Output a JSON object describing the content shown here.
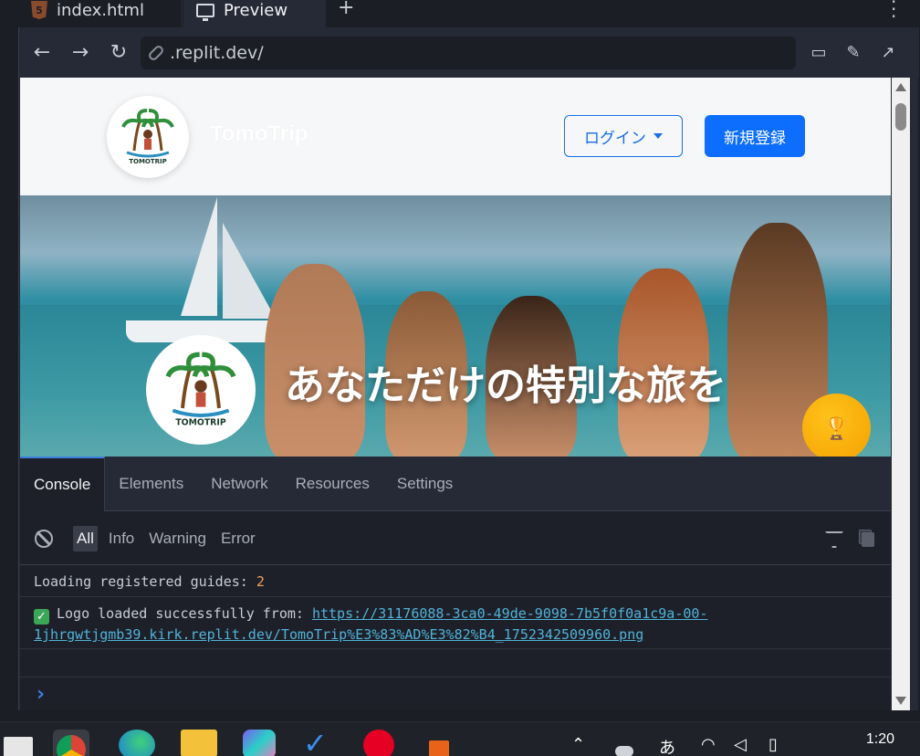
{
  "editor_tabs": [
    {
      "label": "index.html",
      "icon": "html5-icon"
    },
    {
      "label": "Preview",
      "icon": "monitor-icon"
    }
  ],
  "browser": {
    "address": ".replit.dev/"
  },
  "site": {
    "brand": "TomoTrip",
    "logo_caption": "TOMOTRIP",
    "login_label": "ログイン",
    "signup_label": "新規登録",
    "hero_title": "あなただけの特別な旅を",
    "hero_logo_caption": "TOMOTRIP"
  },
  "devtools": {
    "tabs": [
      "Console",
      "Elements",
      "Network",
      "Resources",
      "Settings"
    ],
    "active_tab": "Console",
    "levels": [
      "All",
      "Info",
      "Warning",
      "Error"
    ],
    "active_level": "All",
    "logs": {
      "line1_text": "Loading registered guides:",
      "line1_count": "2",
      "line2_text": "Logo loaded successfully from:",
      "line2_url": "https://31176088-3ca0-49de-9098-7b5f0f0a1c9a-00-1jhrgwtjgmb39.kirk.replit.dev/TomoTrip%E3%83%AD%E3%82%B4_1752342509960.png"
    }
  },
  "taskbar": {
    "clock": "1:20",
    "ime": "あ"
  },
  "colors": {
    "primary": "#0d6efd",
    "devtools_bg": "#1e2029",
    "link": "#4fb3d9",
    "count": "#f0a05a",
    "trophy": "#f5a100"
  }
}
